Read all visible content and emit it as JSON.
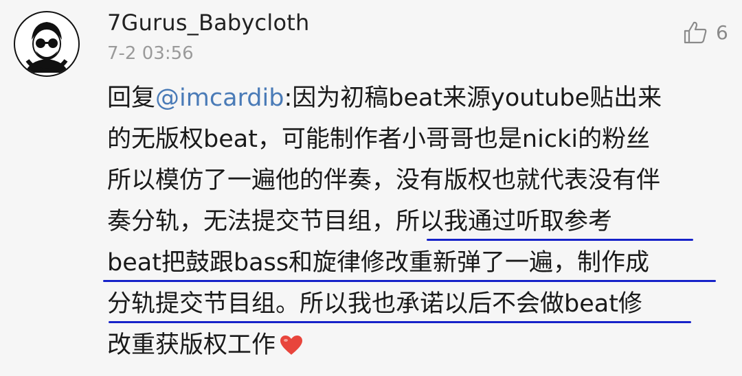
{
  "comment": {
    "username": "7Gurus_Babycloth",
    "timestamp": "7-2 03:56",
    "likes": "6",
    "reply_prefix": "回复",
    "mention": "@imcardib",
    "lines": [
      ":因为初稿beat来源youtube贴出来",
      "的无版权beat，可能制作者小哥哥也是nicki的粉丝",
      "所以模仿了一遍他的伴奏，没有版权也就代表没有伴",
      "奏分轨，无法提交节目组，所以我通过听取参考",
      "beat把鼓跟bass和旋律修改重新弹了一遍，制作成",
      "分轨提交节目组。所以我也承诺以后不会做beat修",
      "改重获版权工作"
    ],
    "underline_color": "#1622c9",
    "heart_color": "#e8453c"
  },
  "icons": {
    "avatar": "avatar-portrait",
    "like": "thumbs-up-icon",
    "emoji": "red-heart-icon"
  }
}
